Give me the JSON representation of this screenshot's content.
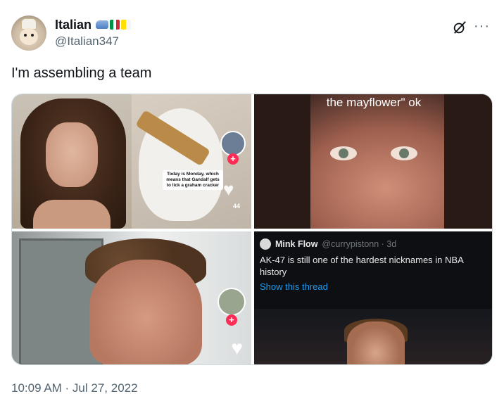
{
  "author": {
    "display_name": "Italian",
    "handle": "@Italian347",
    "badge_icons": [
      "train-emoji-icon",
      "italy-flag-icon",
      "vatican-flag-icon"
    ]
  },
  "tweet": {
    "text": "I'm assembling a team",
    "timestamp": "10:09 AM · Jul 27, 2022"
  },
  "media": {
    "top_left": {
      "caption": "Today is Monday, which means that Gandalf gets to lick a graham cracker",
      "like_count": "44"
    },
    "top_right": {
      "caption": "the mayflower\" ok"
    },
    "bottom_right": {
      "embedded_tweet": {
        "name": "Mink Flow",
        "meta": "@currypistonn · 3d",
        "text": "AK-47 is still one of the hardest nicknames in NBA history",
        "link": "Show this thread"
      }
    }
  },
  "colors": {
    "text_primary": "#0f1419",
    "text_secondary": "#536471",
    "link_blue": "#1d9bf0",
    "tiktok_red": "#fe2c55"
  }
}
